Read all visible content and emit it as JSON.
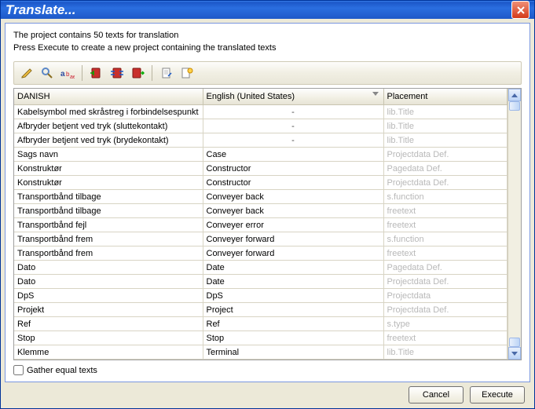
{
  "title": "Translate...",
  "desc1": "The project contains 50 texts for translation",
  "desc2": "Press Execute to create a new project containing the translated texts",
  "toolbar": {
    "icons": [
      "pencil-icon",
      "magnifier-icon",
      "text-icon",
      "book-left-icon",
      "book-swap-icon",
      "book-right-icon",
      "page-icon",
      "page-sun-icon"
    ]
  },
  "columns": {
    "c1": "DANISH",
    "c2": "English (United States)",
    "c3": "Placement"
  },
  "rows": [
    {
      "da": "Kabelsymbol med skråstreg i forbindelsespunkt",
      "en": "-",
      "pl": "lib.Title",
      "dash": true
    },
    {
      "da": "Afbryder betjent ved tryk (sluttekontakt)",
      "en": "-",
      "pl": "lib.Title",
      "dash": true
    },
    {
      "da": "Afbryder betjent ved tryk (brydekontakt)",
      "en": "-",
      "pl": "lib.Title",
      "dash": true
    },
    {
      "da": "Sags navn",
      "en": "Case",
      "pl": "Projectdata Def."
    },
    {
      "da": "Konstruktør",
      "en": "Constructor",
      "pl": "Pagedata Def."
    },
    {
      "da": "Konstruktør",
      "en": "Constructor",
      "pl": "Projectdata Def."
    },
    {
      "da": "Transportbånd tilbage",
      "en": "Conveyer back",
      "pl": "s.function"
    },
    {
      "da": "Transportbånd tilbage",
      "en": "Conveyer back",
      "pl": "freetext"
    },
    {
      "da": "Transportbånd fejl",
      "en": "Conveyer error",
      "pl": "freetext"
    },
    {
      "da": "Transportbånd frem",
      "en": "Conveyer forward",
      "pl": "s.function"
    },
    {
      "da": "Transportbånd frem",
      "en": "Conveyer forward",
      "pl": "freetext"
    },
    {
      "da": "Dato",
      "en": "Date",
      "pl": "Pagedata Def."
    },
    {
      "da": "Dato",
      "en": "Date",
      "pl": "Projectdata Def."
    },
    {
      "da": "DpS",
      "en": "DpS",
      "pl": "Projectdata"
    },
    {
      "da": "Projekt",
      "en": "Project",
      "pl": "Projectdata Def."
    },
    {
      "da": "Ref",
      "en": "Ref",
      "pl": "s.type"
    },
    {
      "da": "Stop",
      "en": "Stop",
      "pl": "freetext"
    },
    {
      "da": "Klemme",
      "en": "Terminal",
      "pl": "lib.Title"
    }
  ],
  "gather_label": "Gather equal texts",
  "cancel_label": "Cancel",
  "execute_label": "Execute"
}
